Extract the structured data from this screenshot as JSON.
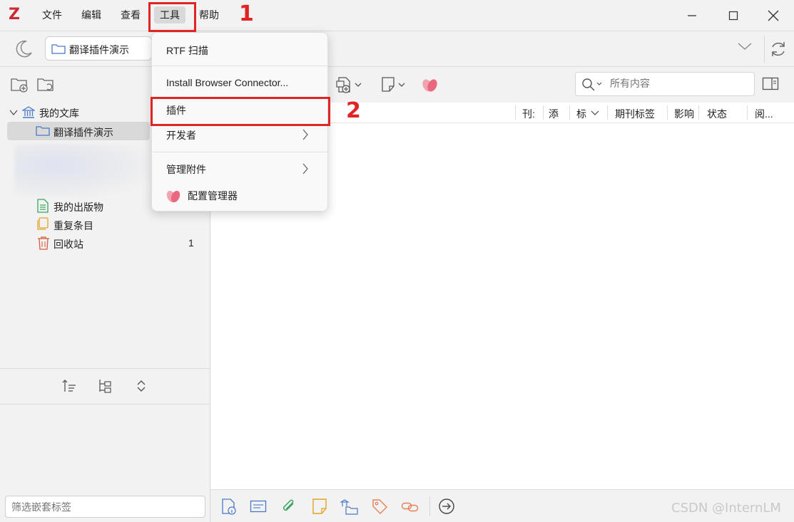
{
  "app": {
    "logo": "Z"
  },
  "menubar": {
    "items": [
      {
        "label": "文件"
      },
      {
        "label": "编辑"
      },
      {
        "label": "查看"
      },
      {
        "label": "工具"
      },
      {
        "label": "帮助"
      }
    ]
  },
  "toolbar2": {
    "collection_tab_label": "翻译插件演示"
  },
  "library": {
    "my_library": "我的文库",
    "selected_collection": "翻译插件演示",
    "my_publications": "我的出版物",
    "duplicates": "重复条目",
    "trash": "回收站",
    "trash_count": "1"
  },
  "tag_filter": {
    "placeholder": "筛选嵌套标签"
  },
  "search": {
    "placeholder": "所有内容"
  },
  "columns": [
    {
      "label": "刊:"
    },
    {
      "label": "添"
    },
    {
      "label": "标"
    },
    {
      "label": "期刊标签"
    },
    {
      "label": "影响"
    },
    {
      "label": "状态"
    },
    {
      "label": "阅..."
    }
  ],
  "tools_menu": {
    "items": [
      {
        "label": "RTF 扫描"
      },
      {
        "label": "Install Browser Connector..."
      },
      {
        "label": "插件"
      },
      {
        "label": "开发者"
      },
      {
        "label": "管理附件"
      },
      {
        "label": "配置管理器"
      }
    ]
  },
  "annotations": {
    "step1": "1",
    "step2": "2"
  },
  "watermark": "CSDN @InternLM",
  "colors": {
    "accent_red": "#e02424",
    "zotero_red": "#cc2936",
    "folder_blue": "#4a78c9"
  }
}
